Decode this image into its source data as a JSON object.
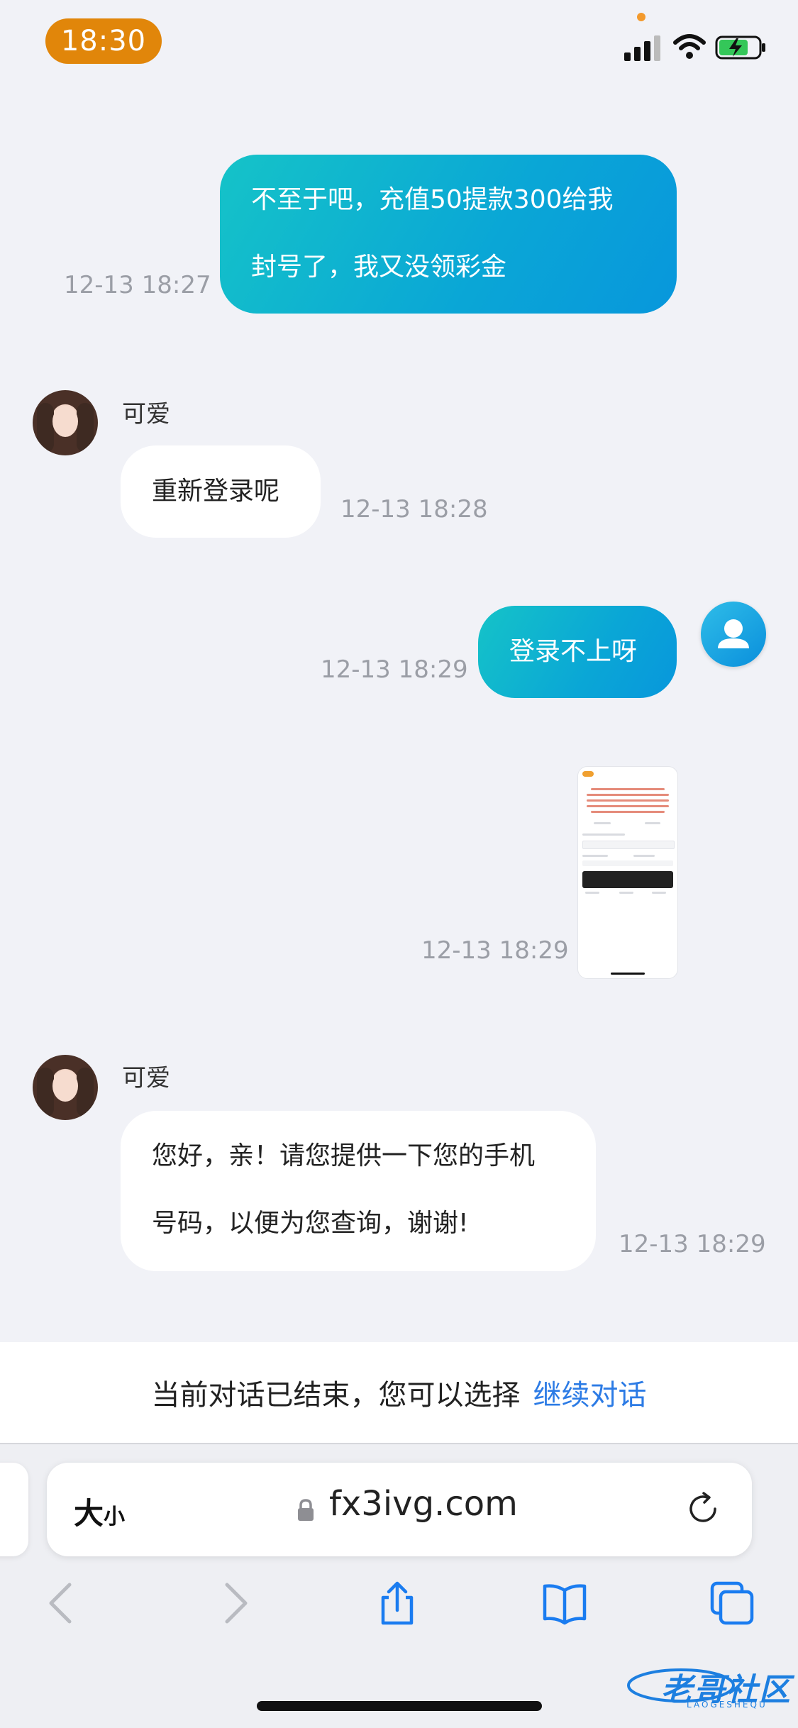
{
  "status_bar": {
    "time": "18:30"
  },
  "messages": [
    {
      "line1": "不至于吧，充值50提款300给我",
      "line2": "封号了，我又没领彩金",
      "time": "12-13 18:27"
    },
    {
      "nick": "可爱",
      "text": "重新登录呢",
      "time": "12-13 18:28"
    },
    {
      "text": "登录不上呀",
      "time": "12-13 18:29"
    },
    {
      "time": "12-13 18:29"
    },
    {
      "nick": "可爱",
      "line1": "您好，亲！请您提供一下您的手机",
      "line2": "号码，以便为您查询，谢谢!",
      "time": "12-13 18:29"
    }
  ],
  "banner": {
    "text": "当前对话已结束，您可以选择",
    "link": "继续对话"
  },
  "browser": {
    "text_size_big": "大",
    "text_size_small": "小",
    "url": "fx3ivg.com"
  },
  "icons": [
    "lock-icon",
    "reload-icon",
    "back-icon",
    "forward-icon",
    "share-icon",
    "bookmarks-icon",
    "tabs-icon"
  ],
  "colors": {
    "outgoing_bubble": "#0aa6d6",
    "link": "#2c7be5",
    "time_pill": "#e1860a"
  },
  "watermark": {
    "text": "老哥社区",
    "sub": "LAOGESHEQU"
  }
}
